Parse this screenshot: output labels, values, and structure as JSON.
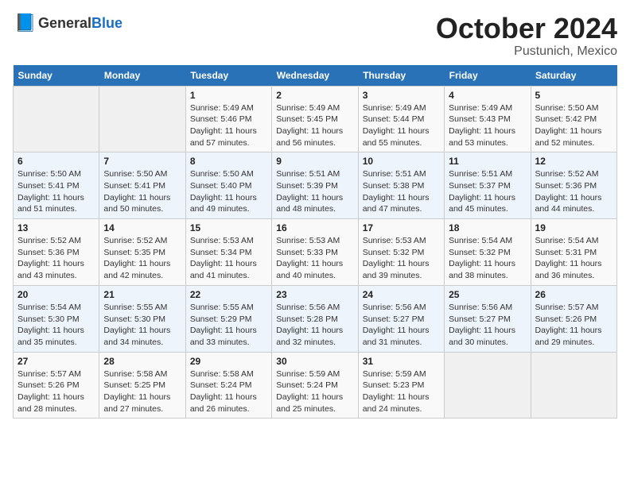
{
  "header": {
    "logo_general": "General",
    "logo_blue": "Blue",
    "title": "October 2024",
    "subtitle": "Pustunich, Mexico"
  },
  "weekdays": [
    "Sunday",
    "Monday",
    "Tuesday",
    "Wednesday",
    "Thursday",
    "Friday",
    "Saturday"
  ],
  "weeks": [
    [
      {
        "day": "",
        "info": ""
      },
      {
        "day": "",
        "info": ""
      },
      {
        "day": "1",
        "info": "Sunrise: 5:49 AM\nSunset: 5:46 PM\nDaylight: 11 hours and 57 minutes."
      },
      {
        "day": "2",
        "info": "Sunrise: 5:49 AM\nSunset: 5:45 PM\nDaylight: 11 hours and 56 minutes."
      },
      {
        "day": "3",
        "info": "Sunrise: 5:49 AM\nSunset: 5:44 PM\nDaylight: 11 hours and 55 minutes."
      },
      {
        "day": "4",
        "info": "Sunrise: 5:49 AM\nSunset: 5:43 PM\nDaylight: 11 hours and 53 minutes."
      },
      {
        "day": "5",
        "info": "Sunrise: 5:50 AM\nSunset: 5:42 PM\nDaylight: 11 hours and 52 minutes."
      }
    ],
    [
      {
        "day": "6",
        "info": "Sunrise: 5:50 AM\nSunset: 5:41 PM\nDaylight: 11 hours and 51 minutes."
      },
      {
        "day": "7",
        "info": "Sunrise: 5:50 AM\nSunset: 5:41 PM\nDaylight: 11 hours and 50 minutes."
      },
      {
        "day": "8",
        "info": "Sunrise: 5:50 AM\nSunset: 5:40 PM\nDaylight: 11 hours and 49 minutes."
      },
      {
        "day": "9",
        "info": "Sunrise: 5:51 AM\nSunset: 5:39 PM\nDaylight: 11 hours and 48 minutes."
      },
      {
        "day": "10",
        "info": "Sunrise: 5:51 AM\nSunset: 5:38 PM\nDaylight: 11 hours and 47 minutes."
      },
      {
        "day": "11",
        "info": "Sunrise: 5:51 AM\nSunset: 5:37 PM\nDaylight: 11 hours and 45 minutes."
      },
      {
        "day": "12",
        "info": "Sunrise: 5:52 AM\nSunset: 5:36 PM\nDaylight: 11 hours and 44 minutes."
      }
    ],
    [
      {
        "day": "13",
        "info": "Sunrise: 5:52 AM\nSunset: 5:36 PM\nDaylight: 11 hours and 43 minutes."
      },
      {
        "day": "14",
        "info": "Sunrise: 5:52 AM\nSunset: 5:35 PM\nDaylight: 11 hours and 42 minutes."
      },
      {
        "day": "15",
        "info": "Sunrise: 5:53 AM\nSunset: 5:34 PM\nDaylight: 11 hours and 41 minutes."
      },
      {
        "day": "16",
        "info": "Sunrise: 5:53 AM\nSunset: 5:33 PM\nDaylight: 11 hours and 40 minutes."
      },
      {
        "day": "17",
        "info": "Sunrise: 5:53 AM\nSunset: 5:32 PM\nDaylight: 11 hours and 39 minutes."
      },
      {
        "day": "18",
        "info": "Sunrise: 5:54 AM\nSunset: 5:32 PM\nDaylight: 11 hours and 38 minutes."
      },
      {
        "day": "19",
        "info": "Sunrise: 5:54 AM\nSunset: 5:31 PM\nDaylight: 11 hours and 36 minutes."
      }
    ],
    [
      {
        "day": "20",
        "info": "Sunrise: 5:54 AM\nSunset: 5:30 PM\nDaylight: 11 hours and 35 minutes."
      },
      {
        "day": "21",
        "info": "Sunrise: 5:55 AM\nSunset: 5:30 PM\nDaylight: 11 hours and 34 minutes."
      },
      {
        "day": "22",
        "info": "Sunrise: 5:55 AM\nSunset: 5:29 PM\nDaylight: 11 hours and 33 minutes."
      },
      {
        "day": "23",
        "info": "Sunrise: 5:56 AM\nSunset: 5:28 PM\nDaylight: 11 hours and 32 minutes."
      },
      {
        "day": "24",
        "info": "Sunrise: 5:56 AM\nSunset: 5:27 PM\nDaylight: 11 hours and 31 minutes."
      },
      {
        "day": "25",
        "info": "Sunrise: 5:56 AM\nSunset: 5:27 PM\nDaylight: 11 hours and 30 minutes."
      },
      {
        "day": "26",
        "info": "Sunrise: 5:57 AM\nSunset: 5:26 PM\nDaylight: 11 hours and 29 minutes."
      }
    ],
    [
      {
        "day": "27",
        "info": "Sunrise: 5:57 AM\nSunset: 5:26 PM\nDaylight: 11 hours and 28 minutes."
      },
      {
        "day": "28",
        "info": "Sunrise: 5:58 AM\nSunset: 5:25 PM\nDaylight: 11 hours and 27 minutes."
      },
      {
        "day": "29",
        "info": "Sunrise: 5:58 AM\nSunset: 5:24 PM\nDaylight: 11 hours and 26 minutes."
      },
      {
        "day": "30",
        "info": "Sunrise: 5:59 AM\nSunset: 5:24 PM\nDaylight: 11 hours and 25 minutes."
      },
      {
        "day": "31",
        "info": "Sunrise: 5:59 AM\nSunset: 5:23 PM\nDaylight: 11 hours and 24 minutes."
      },
      {
        "day": "",
        "info": ""
      },
      {
        "day": "",
        "info": ""
      }
    ]
  ]
}
